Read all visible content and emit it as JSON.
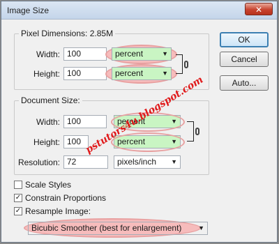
{
  "window": {
    "title": "Image Size",
    "close_icon": "close-icon"
  },
  "pixel_dimensions": {
    "legend": "Pixel Dimensions:",
    "size": "2.85M",
    "width_label": "Width:",
    "width_value": "100",
    "width_unit": "percent",
    "height_label": "Height:",
    "height_value": "100",
    "height_unit": "percent"
  },
  "document_size": {
    "legend": "Document Size:",
    "width_label": "Width:",
    "width_value": "100",
    "width_unit": "percent",
    "height_label": "Height:",
    "height_value": "100",
    "height_unit": "percent",
    "resolution_label": "Resolution:",
    "resolution_value": "72",
    "resolution_unit": "pixels/inch"
  },
  "options": {
    "scale_styles": {
      "label": "Scale Styles",
      "checked": false
    },
    "constrain_proportions": {
      "label": "Constrain Proportions",
      "checked": true
    },
    "resample_image": {
      "label": "Resample Image:",
      "checked": true
    },
    "resample_method": "Bicubic Smoother (best for enlargement)"
  },
  "buttons": {
    "ok": "OK",
    "cancel": "Cancel",
    "auto": "Auto..."
  },
  "watermark": "pstutors4u.blogspot.com",
  "colors": {
    "highlight_green": "#c9f5c3",
    "annotation_pink": "#e8a0a0",
    "watermark_red": "#e0191a"
  }
}
